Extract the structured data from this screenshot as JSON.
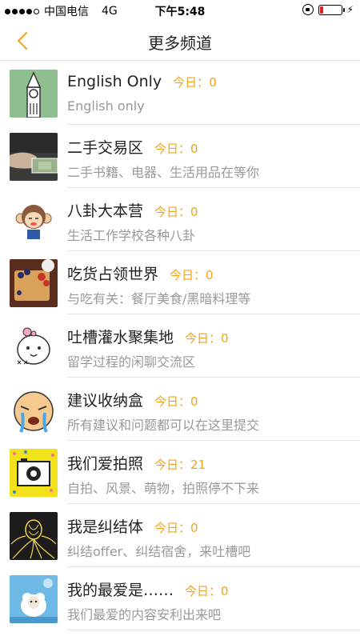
{
  "status_bar": {
    "carrier": "中国电信",
    "network": "4G",
    "time": "下午5:48",
    "signal_dots_filled": 4,
    "signal_dots_total": 5,
    "battery_level": 0.15,
    "battery_color": "#e21f1f"
  },
  "nav": {
    "title": "更多频道",
    "back_icon": "chevron-left-icon",
    "accent_color": "#f3a415"
  },
  "today_label": "今日：",
  "channels": [
    {
      "title": "English Only",
      "today_count": "0",
      "desc": "English only",
      "icon": "big-ben-icon"
    },
    {
      "title": "二手交易区",
      "today_count": "0",
      "desc": "二手书籍、电器、生活用品在等你",
      "icon": "cash-hand-icon"
    },
    {
      "title": "八卦大本营",
      "today_count": "0",
      "desc": "生活工作学校各种八卦",
      "icon": "monkey-icon"
    },
    {
      "title": "吃货占领世界",
      "today_count": "0",
      "desc": "与吃有关：餐厅美食/黑暗料理等",
      "icon": "waffle-berries-icon"
    },
    {
      "title": "吐槽灌水聚集地",
      "today_count": "0",
      "desc": "留学过程的闲聊交流区",
      "icon": "cartoon-cat-icon"
    },
    {
      "title": "建议收纳盒",
      "today_count": "0",
      "desc": "所有建议和问题都可以在这里提交",
      "icon": "crying-face-icon"
    },
    {
      "title": "我们爱拍照",
      "today_count": "21",
      "desc": "自拍、风景、萌物，拍照停不下来",
      "icon": "camera-icon"
    },
    {
      "title": "我是纠结体",
      "today_count": "0",
      "desc": "纠结offer、纠结宿舍，来吐槽吧",
      "icon": "tangled-lines-icon"
    },
    {
      "title": "我的最爱是……",
      "today_count": "0",
      "desc": "我们最爱的内容安利出来吧",
      "icon": "sheep-icon"
    }
  ]
}
